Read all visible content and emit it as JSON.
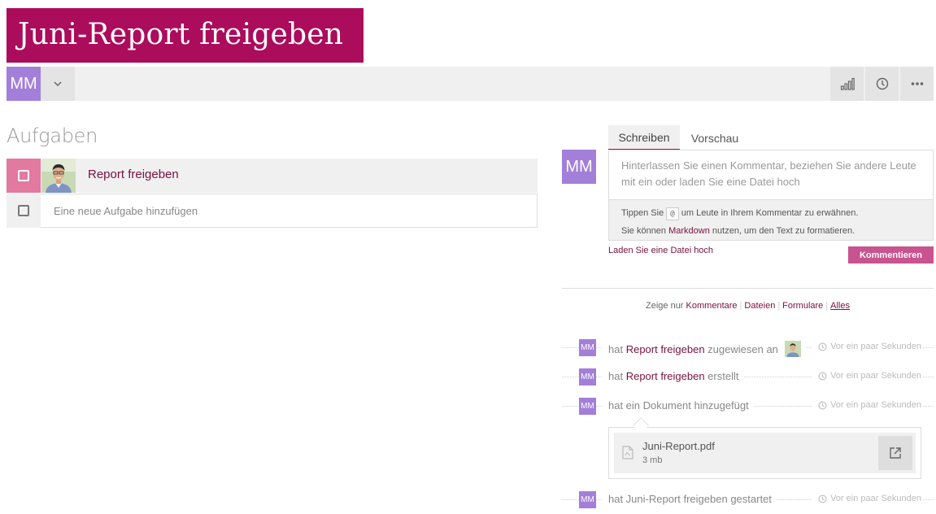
{
  "page": {
    "title": "Juni-Report freigeben"
  },
  "toolbar": {
    "user_initials": "MM",
    "dropdown_icon": "chevron-down-icon",
    "actions": [
      {
        "icon": "signal-bars-icon"
      },
      {
        "icon": "clock-icon"
      },
      {
        "icon": "more-dots-icon"
      }
    ]
  },
  "tasks": {
    "heading": "Aufgaben",
    "items": [
      {
        "label": "Report freigeben",
        "checked": false
      }
    ],
    "new_task_placeholder": "Eine neue Aufgabe hinzufügen"
  },
  "comment": {
    "user_initials": "MM",
    "tabs": [
      "Schreiben",
      "Vorschau"
    ],
    "active_tab": "Schreiben",
    "placeholder": "Hinterlassen Sie einen Kommentar, beziehen Sie andere Leute mit ein oder laden Sie eine Datei hoch",
    "hint_mention_before": "Tippen Sie",
    "hint_mention_key": "@",
    "hint_mention_after": "um Leute in Ihrem Kommentar zu erwähnen.",
    "hint_markdown_before": "Sie können",
    "hint_markdown_link": "Markdown",
    "hint_markdown_after": "nutzen, um den Text zu formatieren.",
    "upload_link": "Laden Sie eine Datei hoch",
    "submit_label": "Kommentieren"
  },
  "filters": {
    "prefix": "Zeige nur",
    "options": [
      "Kommentare",
      "Dateien",
      "Formulare",
      "Alles"
    ],
    "active": "Alles"
  },
  "activities": [
    {
      "initials": "MM",
      "prefix": "hat",
      "link": "Report freigeben",
      "suffix": "zugewiesen an",
      "time": "Vor ein paar Sekunden"
    },
    {
      "initials": "MM",
      "prefix": "hat",
      "link": "Report freigeben",
      "suffix": "erstellt",
      "time": "Vor ein paar Sekunden"
    },
    {
      "initials": "MM",
      "text": "hat ein Dokument hinzugefügt",
      "time": "Vor ein paar Sekunden"
    },
    {
      "initials": "MM",
      "text": "hat Juni-Report freigeben gestartet",
      "time": "Vor ein paar Sekunden"
    }
  ],
  "attachment": {
    "name": "Juni-Report.pdf",
    "size": "3 mb",
    "icon": "pdf-file-icon",
    "action_icon": "external-link-icon"
  },
  "colors": {
    "brand": "#ab0c5b",
    "avatar": "#a27fd9",
    "task_check": "#e2799f",
    "button": "#c9538f",
    "link": "#7a1040"
  }
}
